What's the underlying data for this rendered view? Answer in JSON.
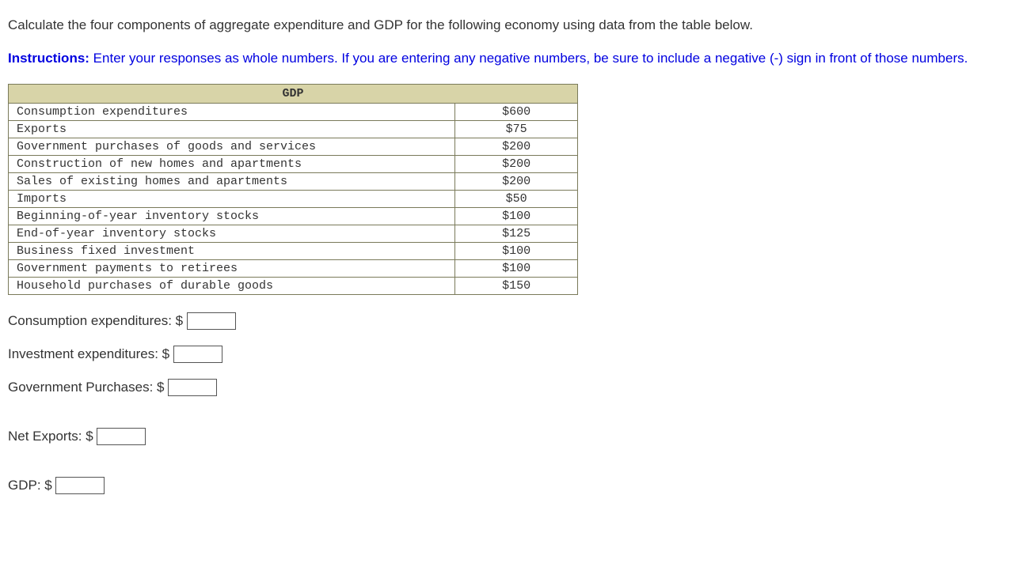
{
  "question": "Calculate the four components of aggregate expenditure and GDP for the following economy using data from the table below.",
  "instructions": {
    "label": "Instructions:",
    "text": " Enter your responses as whole numbers. If you are entering any negative numbers, be sure to include a negative (-) sign in front of those numbers."
  },
  "table": {
    "header": "GDP",
    "rows": [
      {
        "label": "Consumption expenditures",
        "value": "$600"
      },
      {
        "label": "Exports",
        "value": "$75"
      },
      {
        "label": "Government purchases of goods and services",
        "value": "$200"
      },
      {
        "label": "Construction of new homes and apartments",
        "value": "$200"
      },
      {
        "label": "Sales of existing homes and apartments",
        "value": "$200"
      },
      {
        "label": "Imports",
        "value": "$50"
      },
      {
        "label": "Beginning-of-year inventory stocks",
        "value": "$100"
      },
      {
        "label": "End-of-year inventory stocks",
        "value": "$125"
      },
      {
        "label": "Business fixed investment",
        "value": "$100"
      },
      {
        "label": "Government payments to retirees",
        "value": "$100"
      },
      {
        "label": "Household purchases of durable goods",
        "value": "$150"
      }
    ]
  },
  "answers": {
    "consumption": "Consumption expenditures: $ ",
    "investment": "Investment expenditures: $ ",
    "government": "Government Purchases: $ ",
    "netexports": "Net Exports: $ ",
    "gdp": "GDP: $ "
  }
}
